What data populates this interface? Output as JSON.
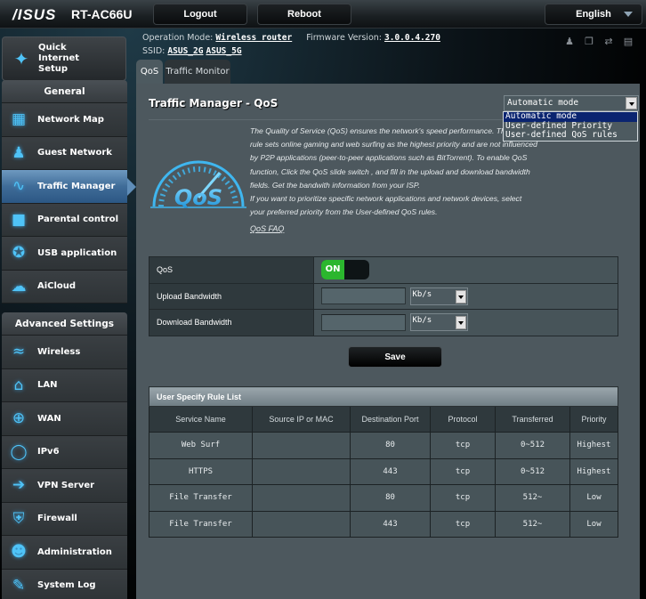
{
  "header": {
    "brand": "/ISUS",
    "model": "RT-AC66U",
    "logout_label": "Logout",
    "reboot_label": "Reboot",
    "language": "English"
  },
  "info": {
    "op_mode_label": "Operation Mode:",
    "op_mode_value": "Wireless router",
    "firmware_label": "Firmware Version:",
    "firmware_value": "3.0.0.4.270",
    "ssid_label": "SSID:",
    "ssid_2g": "ASUS_2G",
    "ssid_5g": "ASUS_5G",
    "status_icons": [
      "clients-icon",
      "network-icon",
      "usb-icon",
      "printer-icon"
    ]
  },
  "sidebar": {
    "quick_setup": "Quick Internet Setup",
    "general_title": "General",
    "general_items": [
      {
        "label": "Network Map",
        "icon": "network-map-icon"
      },
      {
        "label": "Guest Network",
        "icon": "guest-network-icon"
      },
      {
        "label": "Traffic Manager",
        "icon": "traffic-manager-icon",
        "active": true
      },
      {
        "label": "Parental control",
        "icon": "lock-icon"
      },
      {
        "label": "USB application",
        "icon": "puzzle-icon"
      },
      {
        "label": "AiCloud",
        "icon": "cloud-icon"
      }
    ],
    "advanced_title": "Advanced Settings",
    "advanced_items": [
      {
        "label": "Wireless",
        "icon": "wifi-icon"
      },
      {
        "label": "LAN",
        "icon": "home-icon"
      },
      {
        "label": "WAN",
        "icon": "globe-icon"
      },
      {
        "label": "IPv6",
        "icon": "ipv6-icon"
      },
      {
        "label": "VPN Server",
        "icon": "vpn-icon"
      },
      {
        "label": "Firewall",
        "icon": "shield-icon"
      },
      {
        "label": "Administration",
        "icon": "admin-icon"
      },
      {
        "label": "System Log",
        "icon": "log-icon"
      }
    ]
  },
  "tabs": [
    {
      "label": "QoS",
      "active": true
    },
    {
      "label": "Traffic Monitor",
      "active": false
    }
  ],
  "main": {
    "title": "Traffic Manager - QoS",
    "mode_select": {
      "value": "Automatic mode",
      "options": [
        "Automatic mode",
        "User-defined Priority",
        "User-defined QoS rules"
      ],
      "highlighted": "Automatic mode"
    },
    "logo_text": "QoS",
    "description": [
      "The Quality of Service (QoS) ensures the network's speed performance. The default",
      "rule sets online gaming and web surfing as the highest priority and are not influenced",
      "by P2P applications (peer-to-peer applications such as BitTorrent). To enable QoS",
      "function, Click the QoS slide switch , and fill in the upload and download bandwidth",
      "fields. Get the bandwith information from your ISP.",
      "If you want to prioritize specific network applications and network devices, select",
      "your preferred priority from the User-defined QoS rules."
    ],
    "faq_link": "QoS FAQ",
    "settings": {
      "qos_label": "QoS",
      "qos_toggle": "ON",
      "upload_label": "Upload Bandwidth",
      "upload_value": "",
      "upload_unit": "Kb/s",
      "download_label": "Download Bandwidth",
      "download_value": "",
      "download_unit": "Kb/s"
    },
    "save_label": "Save",
    "rule_list": {
      "caption": "User Specify Rule List",
      "columns": [
        "Service Name",
        "Source IP or MAC",
        "Destination Port",
        "Protocol",
        "Transferred",
        "Priority"
      ],
      "rows": [
        [
          "Web Surf",
          "",
          "80",
          "tcp",
          "0~512",
          "Highest"
        ],
        [
          "HTTPS",
          "",
          "443",
          "tcp",
          "0~512",
          "Highest"
        ],
        [
          "File Transfer",
          "",
          "80",
          "tcp",
          "512~",
          "Low"
        ],
        [
          "File Transfer",
          "",
          "443",
          "tcp",
          "512~",
          "Low"
        ]
      ]
    }
  }
}
